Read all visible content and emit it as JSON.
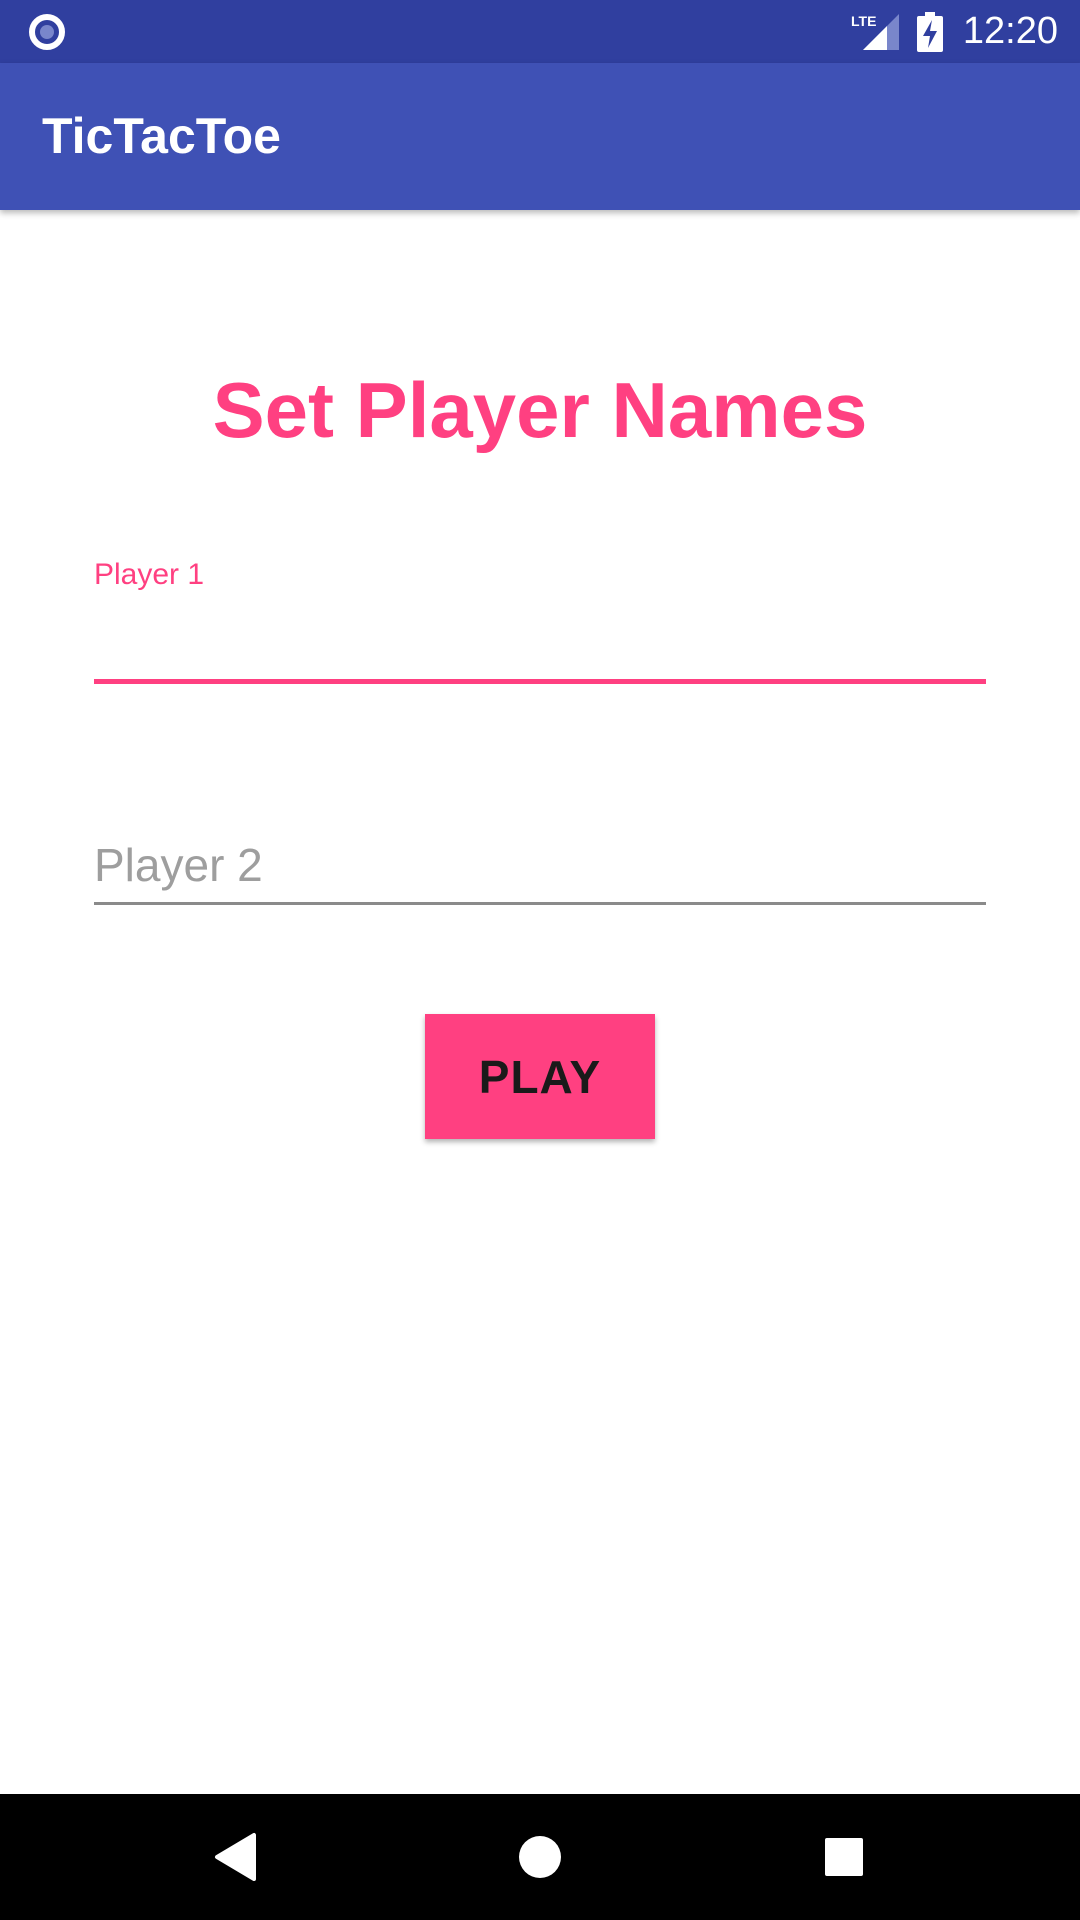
{
  "status_bar": {
    "time": "12:20",
    "network_label": "LTE",
    "icons": [
      "notification-dot-icon",
      "lte-signal-icon",
      "battery-charging-icon"
    ]
  },
  "app_bar": {
    "title": "TicTacToe"
  },
  "main": {
    "heading": "Set Player Names",
    "player1": {
      "floating_label": "Player 1",
      "value": ""
    },
    "player2": {
      "placeholder": "Player 2",
      "value": ""
    },
    "play_label": "PLAY"
  },
  "nav_bar": {
    "icons": [
      "back-icon",
      "home-icon",
      "recents-icon"
    ]
  },
  "colors": {
    "status_bar": "#303F9F",
    "app_bar": "#3F51B5",
    "accent": "#FF4081",
    "nav_bar": "#000000"
  }
}
